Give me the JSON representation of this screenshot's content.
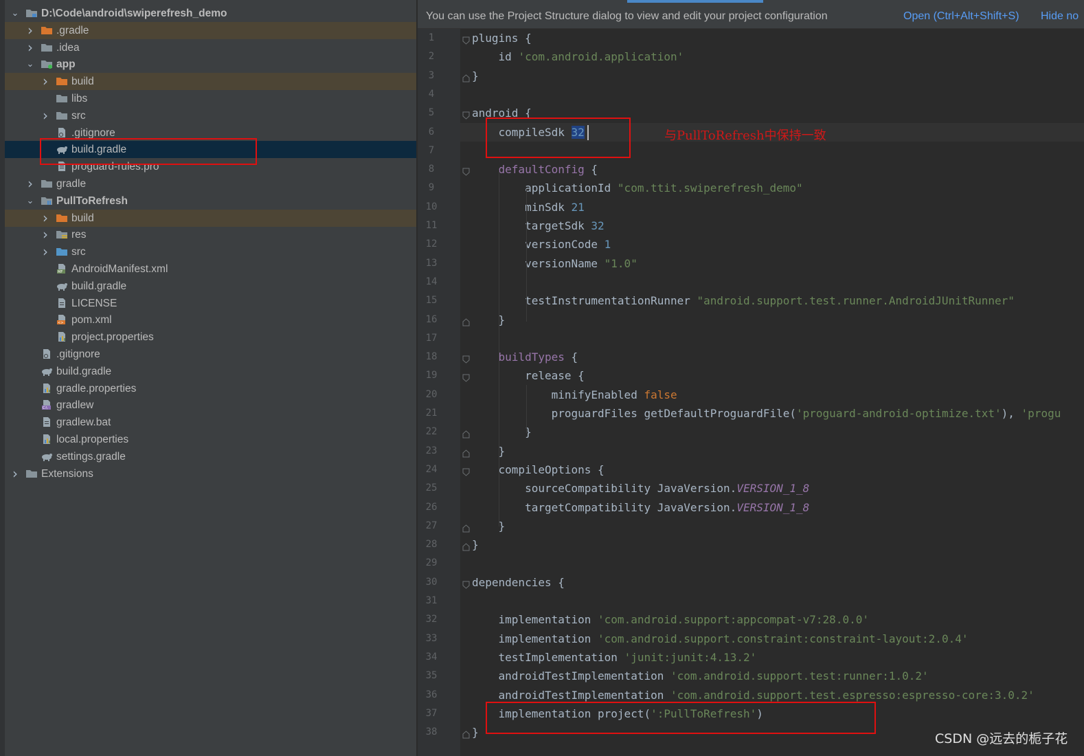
{
  "banner": {
    "message": "You can use the Project Structure dialog to view and edit your project configuration",
    "open_link": "Open (Ctrl+Alt+Shift+S)",
    "hide_link": "Hide no"
  },
  "tree": [
    {
      "label": "D:\\Code\\android\\swiperefresh_demo",
      "bold": true,
      "expanded": true,
      "icon": "module-folder-icon"
    },
    {
      "label": ".gradle",
      "expanded": false,
      "icon": "folder-orange-icon"
    },
    {
      "label": ".idea",
      "expanded": false,
      "icon": "folder-icon"
    },
    {
      "label": "app",
      "bold": true,
      "expanded": true,
      "icon": "app-module-icon"
    },
    {
      "label": "build",
      "expanded": false,
      "icon": "folder-orange-icon"
    },
    {
      "label": "libs",
      "icon": "folder-icon"
    },
    {
      "label": "src",
      "expanded": false,
      "icon": "folder-icon"
    },
    {
      "label": ".gitignore",
      "icon": "gitignore-file-icon"
    },
    {
      "label": "build.gradle",
      "icon": "gradle-file-icon"
    },
    {
      "label": "proguard-rules.pro",
      "icon": "text-file-icon"
    },
    {
      "label": "gradle",
      "expanded": false,
      "icon": "folder-icon"
    },
    {
      "label": "PullToRefresh",
      "bold": true,
      "expanded": true,
      "icon": "library-module-icon"
    },
    {
      "label": "build",
      "expanded": false,
      "icon": "folder-orange-icon"
    },
    {
      "label": "res",
      "expanded": false,
      "icon": "res-folder-icon"
    },
    {
      "label": "src",
      "expanded": false,
      "icon": "source-folder-icon"
    },
    {
      "label": "AndroidManifest.xml",
      "icon": "manifest-file-icon"
    },
    {
      "label": "build.gradle",
      "icon": "gradle-file-icon"
    },
    {
      "label": "LICENSE",
      "icon": "text-file-icon"
    },
    {
      "label": "pom.xml",
      "icon": "xml-file-icon"
    },
    {
      "label": "project.properties",
      "icon": "properties-file-icon"
    },
    {
      "label": ".gitignore",
      "icon": "gitignore-file-icon"
    },
    {
      "label": "build.gradle",
      "icon": "gradle-file-icon"
    },
    {
      "label": "gradle.properties",
      "icon": "properties-file-icon"
    },
    {
      "label": "gradlew",
      "icon": "shell-file-icon"
    },
    {
      "label": "gradlew.bat",
      "icon": "text-file-icon"
    },
    {
      "label": "local.properties",
      "icon": "properties-file-icon"
    },
    {
      "label": "settings.gradle",
      "icon": "gradle-file-icon"
    },
    {
      "label": "Extensions",
      "expanded": false,
      "icon": "folder-icon"
    }
  ],
  "code_lines": [
    [
      [
        "plain",
        "plugins {"
      ]
    ],
    [
      [
        "plain",
        "    id "
      ],
      [
        "st",
        "'com.android.application'"
      ]
    ],
    [
      [
        "plain",
        "}"
      ]
    ],
    [],
    [
      [
        "plain",
        "android {"
      ]
    ],
    [
      [
        "plain",
        "    compileSdk "
      ],
      [
        "selnum",
        "32"
      ]
    ],
    [],
    [
      [
        "plain",
        "    "
      ],
      [
        "pu",
        "defaultConfig"
      ],
      [
        "plain",
        " {"
      ]
    ],
    [
      [
        "plain",
        "        applicationId "
      ],
      [
        "st",
        "\"com.ttit.swiperefresh_demo\""
      ]
    ],
    [
      [
        "plain",
        "        minSdk "
      ],
      [
        "nu",
        "21"
      ]
    ],
    [
      [
        "plain",
        "        targetSdk "
      ],
      [
        "nu",
        "32"
      ]
    ],
    [
      [
        "plain",
        "        versionCode "
      ],
      [
        "nu",
        "1"
      ]
    ],
    [
      [
        "plain",
        "        versionName "
      ],
      [
        "st",
        "\"1.0\""
      ]
    ],
    [],
    [
      [
        "plain",
        "        testInstrumentationRunner "
      ],
      [
        "st",
        "\"android.support.test.runner.AndroidJUnitRunner\""
      ]
    ],
    [
      [
        "plain",
        "    }"
      ]
    ],
    [],
    [
      [
        "plain",
        "    "
      ],
      [
        "pu",
        "buildTypes"
      ],
      [
        "plain",
        " {"
      ]
    ],
    [
      [
        "plain",
        "        release {"
      ]
    ],
    [
      [
        "plain",
        "            minifyEnabled "
      ],
      [
        "kw",
        "false"
      ]
    ],
    [
      [
        "plain",
        "            proguardFiles getDefaultProguardFile("
      ],
      [
        "st",
        "'proguard-android-optimize.txt'"
      ],
      [
        "plain",
        "), "
      ],
      [
        "st",
        "'progu"
      ]
    ],
    [
      [
        "plain",
        "        }"
      ]
    ],
    [
      [
        "plain",
        "    }"
      ]
    ],
    [
      [
        "plain",
        "    compileOptions {"
      ]
    ],
    [
      [
        "plain",
        "        sourceCompatibility JavaVersion."
      ],
      [
        "it",
        "VERSION_1_8"
      ]
    ],
    [
      [
        "plain",
        "        targetCompatibility JavaVersion."
      ],
      [
        "it",
        "VERSION_1_8"
      ]
    ],
    [
      [
        "plain",
        "    }"
      ]
    ],
    [
      [
        "plain",
        "}"
      ]
    ],
    [],
    [
      [
        "plain",
        "dependencies {"
      ]
    ],
    [],
    [
      [
        "plain",
        "    implementation "
      ],
      [
        "st",
        "'com.android.support:appcompat-v7:28.0.0'"
      ]
    ],
    [
      [
        "plain",
        "    implementation "
      ],
      [
        "st",
        "'com.android.support.constraint:constraint-layout:2.0.4'"
      ]
    ],
    [
      [
        "plain",
        "    testImplementation "
      ],
      [
        "st",
        "'junit:junit:4.13.2'"
      ]
    ],
    [
      [
        "plain",
        "    androidTestImplementation "
      ],
      [
        "st",
        "'com.android.support.test:runner:1.0.2'"
      ]
    ],
    [
      [
        "plain",
        "    androidTestImplementation "
      ],
      [
        "st",
        "'com.android.support.test.espresso:espresso-core:3.0.2'"
      ]
    ],
    [
      [
        "plain",
        "    implementation project("
      ],
      [
        "st",
        "':PullToRefresh'"
      ],
      [
        "plain",
        ")"
      ]
    ],
    [
      [
        "plain",
        "}"
      ]
    ]
  ],
  "annotation": "与PullToRefresh中保持一致",
  "watermark": "CSDN @远去的栀子花",
  "colors": {
    "selection": "#0d293e",
    "highlight_row": "#4d4535",
    "red_box": "#e01010",
    "link": "#589df6"
  }
}
